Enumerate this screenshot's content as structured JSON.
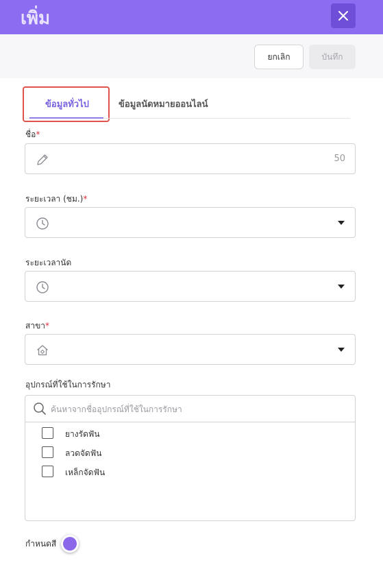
{
  "header": {
    "title": "เพิ่ม",
    "close_icon": "close-icon"
  },
  "toolbar": {
    "cancel_label": "ยกเลิก",
    "save_label": "บันทึก"
  },
  "tabs": [
    {
      "label": "ข้อมูลทั่วไป",
      "active": true
    },
    {
      "label": "ข้อมูลนัดหมายออนไลน์",
      "active": false
    }
  ],
  "form": {
    "name": {
      "label": "ชื่อ",
      "required_mark": "*",
      "value": "",
      "counter": "50",
      "icon": "pencil-icon"
    },
    "duration": {
      "label": "ระยะเวลา (ชม.)",
      "required_mark": "*",
      "value": "",
      "icon": "clock-icon"
    },
    "appointment_duration": {
      "label": "ระยะเวลานัด",
      "value": "",
      "icon": "clock-icon"
    },
    "branch": {
      "label": "สาขา",
      "required_mark": "*",
      "value": "",
      "icon": "home-icon"
    },
    "equipment": {
      "label": "อุปกรณ์ที่ใช้ในการรักษา",
      "search_placeholder": "ค้นหาจากชื่ออุปกรณ์ที่ใช้ในการรักษา",
      "items": [
        {
          "label": "ยางรัดฟัน",
          "checked": false
        },
        {
          "label": "ลวดจัดฟัน",
          "checked": false
        },
        {
          "label": "เหล็กจัดฟัน",
          "checked": false
        }
      ]
    },
    "color": {
      "label": "กำหนดสี",
      "value": "#8b68ea"
    }
  },
  "colors": {
    "accent": "#8c6cf0",
    "required": "#e0303a",
    "highlight": "#e0534a"
  }
}
